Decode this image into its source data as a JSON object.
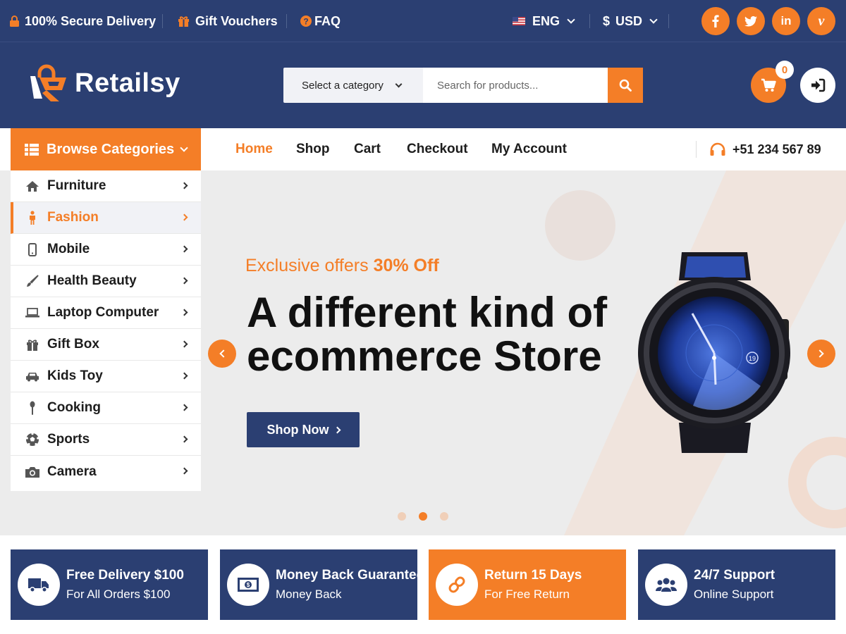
{
  "colors": {
    "primary": "#2b3f72",
    "accent": "#f47e27"
  },
  "topbar": {
    "secure_delivery": "100% Secure Delivery",
    "gift_vouchers": "Gift Vouchers",
    "faq": "FAQ",
    "language": "ENG",
    "currency": "USD",
    "social_icons": [
      "facebook-icon",
      "twitter-icon",
      "linkedin-icon",
      "vimeo-icon"
    ]
  },
  "header": {
    "logo_text": "Retailsy",
    "category_select": "Select a category",
    "search_placeholder": "Search for products...",
    "cart_count": "0"
  },
  "nav": {
    "browse_label": "Browse Categories",
    "links": [
      "Home",
      "Shop",
      "Cart",
      "Checkout",
      "My Account"
    ],
    "active": "Home",
    "phone": "+51 234 567 89"
  },
  "categories": [
    {
      "label": "Furniture",
      "icon": "home-icon"
    },
    {
      "label": "Fashion",
      "icon": "person-icon",
      "active": true
    },
    {
      "label": "Mobile",
      "icon": "mobile-icon"
    },
    {
      "label": "Health Beauty",
      "icon": "brush-icon"
    },
    {
      "label": "Laptop Computer",
      "icon": "laptop-icon"
    },
    {
      "label": "Gift Box",
      "icon": "gift-icon"
    },
    {
      "label": "Kids Toy",
      "icon": "car-icon"
    },
    {
      "label": "Cooking",
      "icon": "spoon-icon"
    },
    {
      "label": "Sports",
      "icon": "ball-icon"
    },
    {
      "label": "Camera",
      "icon": "camera-icon"
    }
  ],
  "hero": {
    "offer_prefix": "Exclusive offers",
    "offer_highlight": "30% Off",
    "headline_line1": "A different kind of",
    "headline_line2": "ecommerce Store",
    "cta": "Shop Now",
    "slides": 3,
    "active_slide": 2,
    "watch_dial_number": "19"
  },
  "features": [
    {
      "title": "Free Delivery $100",
      "subtitle": "For All Orders $100",
      "icon": "truck-icon"
    },
    {
      "title": "Money Back Guarantee",
      "subtitle": "Money Back",
      "icon": "money-icon"
    },
    {
      "title": "Return 15 Days",
      "subtitle": "For Free Return",
      "icon": "link-icon"
    },
    {
      "title": "24/7 Support",
      "subtitle": "Online Support",
      "icon": "users-icon"
    }
  ]
}
